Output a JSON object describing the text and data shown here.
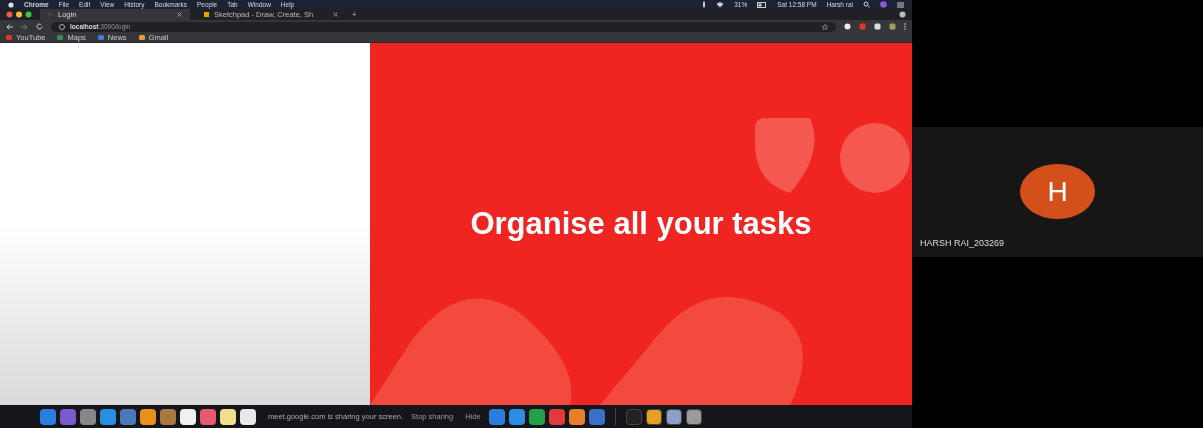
{
  "menu_bar": {
    "items": [
      "Chrome",
      "File",
      "Edit",
      "View",
      "History",
      "Bookmarks",
      "People",
      "Tab",
      "Window",
      "Help"
    ],
    "battery": "31%",
    "clock": "Sat 12:58 PM",
    "user": "Harsh rai"
  },
  "tabs": [
    {
      "label": "Login",
      "selected": true
    },
    {
      "label": "Sketchpad - Draw, Create, Sh",
      "selected": false
    }
  ],
  "new_tab": "+",
  "address_bar": {
    "host": "localhost",
    "path": ":3000/login"
  },
  "bookmarks": [
    "YouTube",
    "Maps",
    "News",
    "Gmail"
  ],
  "page": {
    "headline": "Organise all your tasks"
  },
  "dock": {
    "share_notice": "meet.google.com is sharing your screen.",
    "stop_button": "Stop sharing",
    "hide_button": "Hide"
  },
  "participant": {
    "initial": "H",
    "name": "HARSH RAI_203269"
  }
}
